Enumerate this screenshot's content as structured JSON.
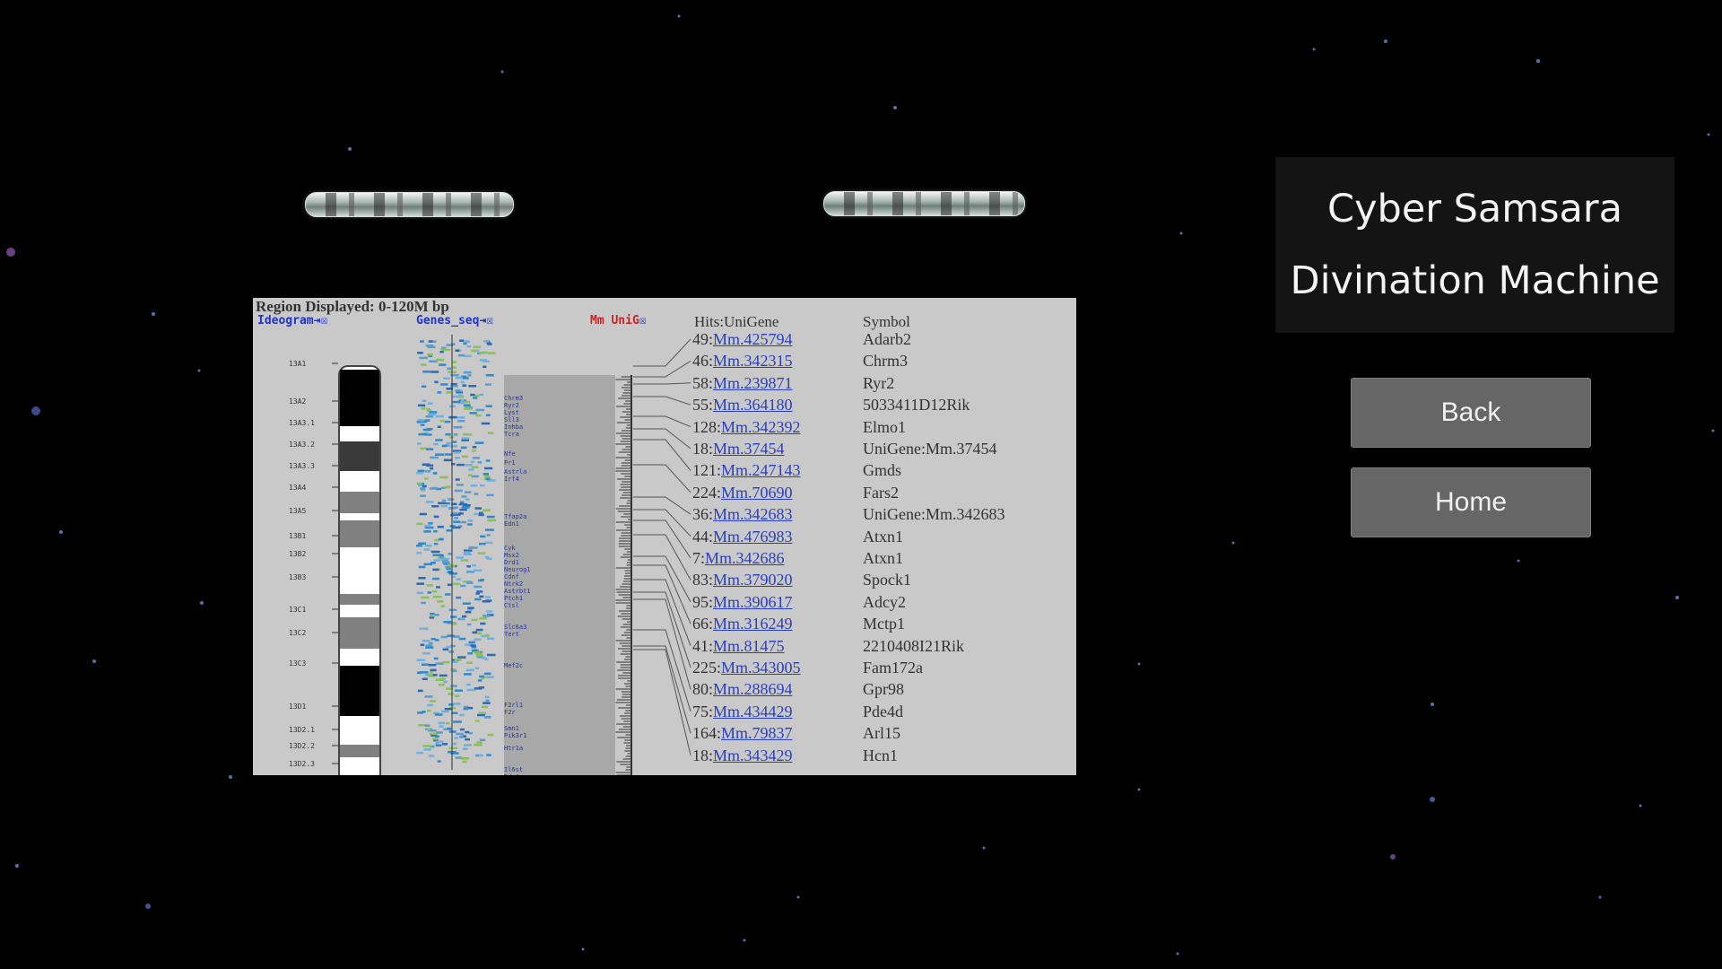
{
  "title": {
    "line1": "Cyber Samsara",
    "line2": "Divination Machine"
  },
  "buttons": {
    "back": "Back",
    "home": "Home"
  },
  "browser": {
    "region": "Region Displayed: 0-120M bp",
    "ideogram_label": "Ideogram",
    "genes_label": "Genes_seq",
    "unig_mm": "Mm",
    "unig_label": "UniG",
    "hits_header": "Hits:UniGene",
    "symbol_header": "Symbol",
    "bands": [
      "13A1",
      "13A2",
      "13A3.1",
      "13A3.2",
      "13A3.3",
      "13A4",
      "13A5",
      "13B1",
      "13B2",
      "13B3",
      "13C1",
      "13C2",
      "13C3",
      "13D1",
      "13D2.1",
      "13D2.2",
      "13D2.3"
    ],
    "hits": [
      {
        "count": "49:",
        "id": "Mm.425794",
        "symbol": "Adarb2"
      },
      {
        "count": "46:",
        "id": "Mm.342315",
        "symbol": "Chrm3"
      },
      {
        "count": "58:",
        "id": "Mm.239871",
        "symbol": "Ryr2"
      },
      {
        "count": "55:",
        "id": "Mm.364180",
        "symbol": "5033411D12Rik"
      },
      {
        "count": "128:",
        "id": "Mm.342392",
        "symbol": "Elmo1"
      },
      {
        "count": "18:",
        "id": "Mm.37454",
        "symbol": "UniGene:Mm.37454"
      },
      {
        "count": "121:",
        "id": "Mm.247143",
        "symbol": "Gmds"
      },
      {
        "count": "224:",
        "id": "Mm.70690",
        "symbol": "Fars2"
      },
      {
        "count": "36:",
        "id": "Mm.342683",
        "symbol": "UniGene:Mm.342683"
      },
      {
        "count": "44:",
        "id": "Mm.476983",
        "symbol": "Atxn1"
      },
      {
        "count": "7:",
        "id": "Mm.342686",
        "symbol": "Atxn1"
      },
      {
        "count": "83:",
        "id": "Mm.379020",
        "symbol": "Spock1"
      },
      {
        "count": "95:",
        "id": "Mm.390617",
        "symbol": "Adcy2"
      },
      {
        "count": "66:",
        "id": "Mm.316249",
        "symbol": "Mctp1"
      },
      {
        "count": "41:",
        "id": "Mm.81475",
        "symbol": "2210408I21Rik"
      },
      {
        "count": "225:",
        "id": "Mm.343005",
        "symbol": "Fam172a"
      },
      {
        "count": "80:",
        "id": "Mm.288694",
        "symbol": "Gpr98"
      },
      {
        "count": "75:",
        "id": "Mm.434429",
        "symbol": "Pde4d"
      },
      {
        "count": "164:",
        "id": "Mm.79837",
        "symbol": "Arl15"
      },
      {
        "count": "18:",
        "id": "Mm.343429",
        "symbol": "Hcn1"
      }
    ]
  }
}
